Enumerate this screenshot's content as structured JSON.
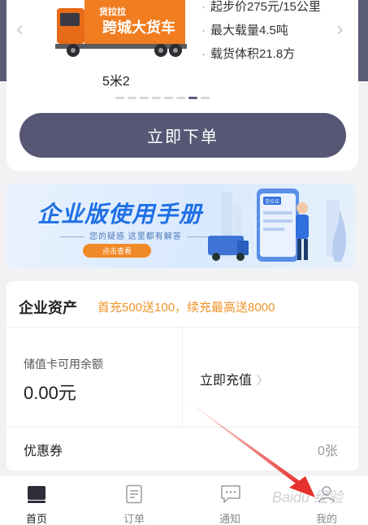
{
  "vehicle": {
    "specs": [
      "起步价275元/15公里",
      "最大载量4.5吨",
      "载货体积21.8方"
    ],
    "truck_brand": "货拉拉",
    "truck_slogan": "跨城大货车",
    "name": "5米2",
    "order_button": "立即下单",
    "carousel_total": 8,
    "carousel_active_index": 6
  },
  "banner": {
    "title": "企业版使用手册",
    "subtitle": "您的疑惑  这里都有解答",
    "button": "点击查看",
    "illustration_label": "货拉拉"
  },
  "assets": {
    "title": "企业资产",
    "promo": "首充500送100，续充最高送8000",
    "balance_label": "储值卡可用余额",
    "balance_value": "0.00元",
    "recharge_label": "立即充值",
    "coupon_label": "优惠券",
    "coupon_count": "0张"
  },
  "tabs": {
    "home": "首页",
    "orders": "订单",
    "notice": "通知",
    "mine": "我的",
    "active": "home"
  },
  "colors": {
    "primary": "#575775",
    "accent_orange": "#f0932a",
    "banner_blue": "#1f6fe6",
    "annotation_red": "#e5322d"
  },
  "annotation": {
    "type": "red-arrow",
    "points_to": "tab-mine"
  },
  "watermark": "Baidu 经验"
}
